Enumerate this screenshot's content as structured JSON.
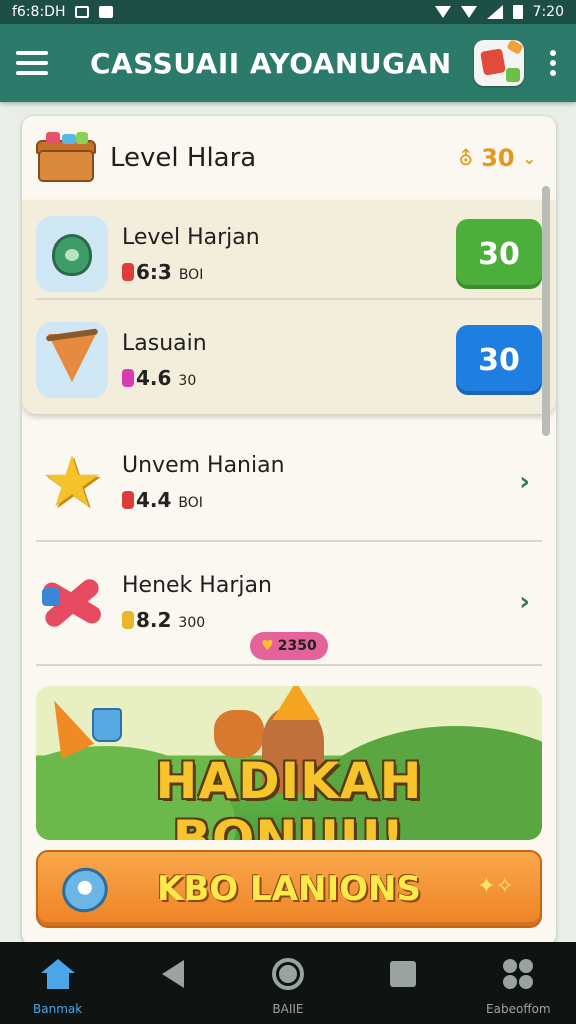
{
  "status_bar": {
    "left_text": "f6:8:DH",
    "time": "7:20"
  },
  "app_bar": {
    "title": "CASSUAII AYOANUGAN",
    "menu_icon": "hamburger-icon",
    "more_icon": "kebab-icon"
  },
  "card": {
    "header": {
      "title": "Level Hlara",
      "points": "30"
    },
    "rows": [
      {
        "title": "Level Harjan",
        "subtitle": "6:3",
        "subtitle_small": "BOI",
        "button_label": "30",
        "button_color": "#4cae3b",
        "tag_color": "#e03c3c"
      },
      {
        "title": "Lasuain",
        "subtitle": "4.6",
        "subtitle_small": "30",
        "button_label": "30",
        "button_color": "#1f7fe0",
        "tag_color": "#d83cb4"
      },
      {
        "title": "Unvem Hanian",
        "subtitle": "4.4",
        "subtitle_small": "BOI",
        "tag_color": "#e03c3c"
      },
      {
        "title": "Henek Harjan",
        "subtitle": "8.2",
        "subtitle_small": "300",
        "tag_color": "#e8b82a"
      }
    ],
    "coin_badge": "2350",
    "banner_text": "HADIKAH BONUU!",
    "cta_label": "KBO LANIONS"
  },
  "bottom_nav": {
    "items": [
      {
        "label": "Banmak",
        "icon": "home-icon",
        "active": true
      },
      {
        "label": "",
        "icon": "back-icon",
        "active": false
      },
      {
        "label": "BAIIE",
        "icon": "home-circle-icon",
        "active": false
      },
      {
        "label": "",
        "icon": "recents-icon",
        "active": false
      },
      {
        "label": "Eabeoffom",
        "icon": "puzzle-icon",
        "active": false
      }
    ]
  }
}
